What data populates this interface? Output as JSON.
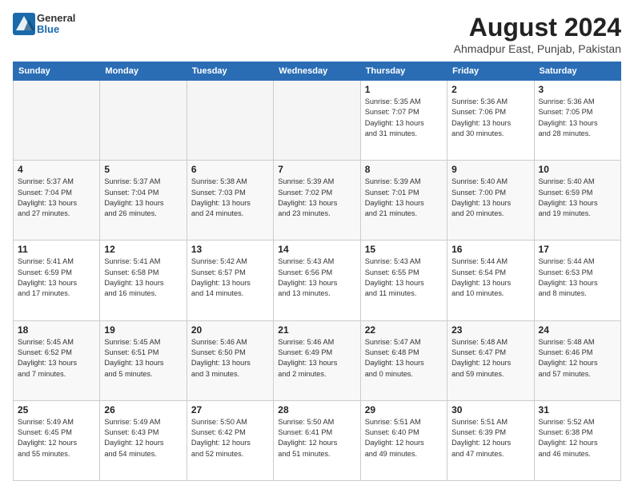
{
  "logo": {
    "general": "General",
    "blue": "Blue"
  },
  "header": {
    "title": "August 2024",
    "subtitle": "Ahmadpur East, Punjab, Pakistan"
  },
  "days_of_week": [
    "Sunday",
    "Monday",
    "Tuesday",
    "Wednesday",
    "Thursday",
    "Friday",
    "Saturday"
  ],
  "weeks": [
    [
      {
        "day": "",
        "info": ""
      },
      {
        "day": "",
        "info": ""
      },
      {
        "day": "",
        "info": ""
      },
      {
        "day": "",
        "info": ""
      },
      {
        "day": "1",
        "info": "Sunrise: 5:35 AM\nSunset: 7:07 PM\nDaylight: 13 hours\nand 31 minutes."
      },
      {
        "day": "2",
        "info": "Sunrise: 5:36 AM\nSunset: 7:06 PM\nDaylight: 13 hours\nand 30 minutes."
      },
      {
        "day": "3",
        "info": "Sunrise: 5:36 AM\nSunset: 7:05 PM\nDaylight: 13 hours\nand 28 minutes."
      }
    ],
    [
      {
        "day": "4",
        "info": "Sunrise: 5:37 AM\nSunset: 7:04 PM\nDaylight: 13 hours\nand 27 minutes."
      },
      {
        "day": "5",
        "info": "Sunrise: 5:37 AM\nSunset: 7:04 PM\nDaylight: 13 hours\nand 26 minutes."
      },
      {
        "day": "6",
        "info": "Sunrise: 5:38 AM\nSunset: 7:03 PM\nDaylight: 13 hours\nand 24 minutes."
      },
      {
        "day": "7",
        "info": "Sunrise: 5:39 AM\nSunset: 7:02 PM\nDaylight: 13 hours\nand 23 minutes."
      },
      {
        "day": "8",
        "info": "Sunrise: 5:39 AM\nSunset: 7:01 PM\nDaylight: 13 hours\nand 21 minutes."
      },
      {
        "day": "9",
        "info": "Sunrise: 5:40 AM\nSunset: 7:00 PM\nDaylight: 13 hours\nand 20 minutes."
      },
      {
        "day": "10",
        "info": "Sunrise: 5:40 AM\nSunset: 6:59 PM\nDaylight: 13 hours\nand 19 minutes."
      }
    ],
    [
      {
        "day": "11",
        "info": "Sunrise: 5:41 AM\nSunset: 6:59 PM\nDaylight: 13 hours\nand 17 minutes."
      },
      {
        "day": "12",
        "info": "Sunrise: 5:41 AM\nSunset: 6:58 PM\nDaylight: 13 hours\nand 16 minutes."
      },
      {
        "day": "13",
        "info": "Sunrise: 5:42 AM\nSunset: 6:57 PM\nDaylight: 13 hours\nand 14 minutes."
      },
      {
        "day": "14",
        "info": "Sunrise: 5:43 AM\nSunset: 6:56 PM\nDaylight: 13 hours\nand 13 minutes."
      },
      {
        "day": "15",
        "info": "Sunrise: 5:43 AM\nSunset: 6:55 PM\nDaylight: 13 hours\nand 11 minutes."
      },
      {
        "day": "16",
        "info": "Sunrise: 5:44 AM\nSunset: 6:54 PM\nDaylight: 13 hours\nand 10 minutes."
      },
      {
        "day": "17",
        "info": "Sunrise: 5:44 AM\nSunset: 6:53 PM\nDaylight: 13 hours\nand 8 minutes."
      }
    ],
    [
      {
        "day": "18",
        "info": "Sunrise: 5:45 AM\nSunset: 6:52 PM\nDaylight: 13 hours\nand 7 minutes."
      },
      {
        "day": "19",
        "info": "Sunrise: 5:45 AM\nSunset: 6:51 PM\nDaylight: 13 hours\nand 5 minutes."
      },
      {
        "day": "20",
        "info": "Sunrise: 5:46 AM\nSunset: 6:50 PM\nDaylight: 13 hours\nand 3 minutes."
      },
      {
        "day": "21",
        "info": "Sunrise: 5:46 AM\nSunset: 6:49 PM\nDaylight: 13 hours\nand 2 minutes."
      },
      {
        "day": "22",
        "info": "Sunrise: 5:47 AM\nSunset: 6:48 PM\nDaylight: 13 hours\nand 0 minutes."
      },
      {
        "day": "23",
        "info": "Sunrise: 5:48 AM\nSunset: 6:47 PM\nDaylight: 12 hours\nand 59 minutes."
      },
      {
        "day": "24",
        "info": "Sunrise: 5:48 AM\nSunset: 6:46 PM\nDaylight: 12 hours\nand 57 minutes."
      }
    ],
    [
      {
        "day": "25",
        "info": "Sunrise: 5:49 AM\nSunset: 6:45 PM\nDaylight: 12 hours\nand 55 minutes."
      },
      {
        "day": "26",
        "info": "Sunrise: 5:49 AM\nSunset: 6:43 PM\nDaylight: 12 hours\nand 54 minutes."
      },
      {
        "day": "27",
        "info": "Sunrise: 5:50 AM\nSunset: 6:42 PM\nDaylight: 12 hours\nand 52 minutes."
      },
      {
        "day": "28",
        "info": "Sunrise: 5:50 AM\nSunset: 6:41 PM\nDaylight: 12 hours\nand 51 minutes."
      },
      {
        "day": "29",
        "info": "Sunrise: 5:51 AM\nSunset: 6:40 PM\nDaylight: 12 hours\nand 49 minutes."
      },
      {
        "day": "30",
        "info": "Sunrise: 5:51 AM\nSunset: 6:39 PM\nDaylight: 12 hours\nand 47 minutes."
      },
      {
        "day": "31",
        "info": "Sunrise: 5:52 AM\nSunset: 6:38 PM\nDaylight: 12 hours\nand 46 minutes."
      }
    ]
  ]
}
